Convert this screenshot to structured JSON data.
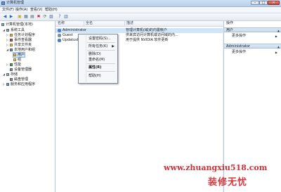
{
  "window": {
    "title": "计算机管理",
    "minimize_glyph": "–",
    "maximize_glyph": "□",
    "close_glyph": "✕"
  },
  "menubar": {
    "items": [
      "文件(F)",
      "操作(A)",
      "查看(V)",
      "帮助(H)"
    ]
  },
  "toolbar": {
    "buttons": [
      {
        "icon": "back-arrow-icon",
        "glyph": "◀",
        "color": "#2a6ab8"
      },
      {
        "icon": "forward-arrow-icon",
        "glyph": "▶",
        "color": "#2a6ab8"
      },
      {
        "icon": "up-folder-icon",
        "glyph": "▣",
        "color": "#caa23a"
      },
      {
        "icon": "show-hide-tree-icon",
        "glyph": "▦",
        "color": "#4a6f9e"
      },
      {
        "icon": "properties-icon",
        "glyph": "▤",
        "color": "#5a5a5a"
      },
      {
        "icon": "delete-icon",
        "glyph": "✖",
        "color": "#cc2222"
      },
      {
        "icon": "refresh-icon",
        "glyph": "⟳",
        "color": "#2a8a3a"
      },
      {
        "icon": "export-list-icon",
        "glyph": "▧",
        "color": "#4a6f9e"
      },
      {
        "icon": "help-icon",
        "glyph": "?",
        "color": "#2a5ab8"
      },
      {
        "icon": "action-pane-icon",
        "glyph": "▥",
        "color": "#4a6f9e"
      }
    ]
  },
  "tree": {
    "root": "计算机管理(本地)",
    "system_tools": "系统工具",
    "task_scheduler": "任务计划程序",
    "event_viewer": "事件查看器",
    "shared_folders": "共享文件夹",
    "local_users_groups": "本地用户和组",
    "users": "用户",
    "groups": "组",
    "performance": "性能",
    "device_manager": "设备管理器",
    "storage": "存储",
    "disk_management": "磁盘管理",
    "services_apps": "服务和应用程序"
  },
  "list": {
    "columns": [
      "名称",
      "全名",
      "描述"
    ],
    "rows": [
      {
        "name": "Administrator",
        "fullname": "",
        "description": "管理计算机(域)的内置帐户"
      },
      {
        "name": "Guest",
        "fullname": "",
        "description": "供来宾访问计算机或访问域的内..."
      },
      {
        "name": "UpdatusUser",
        "fullname": "",
        "description": "用于提供 NVIDIA 软件更新"
      }
    ]
  },
  "context_menu": {
    "items": [
      "设置密码(S)...",
      "所有任务(K)",
      "删除(D)",
      "重命名(M)",
      "属性(R)",
      "帮助(H)"
    ],
    "submenu_arrow": "▶"
  },
  "actions_pane": {
    "header": "操作",
    "section1": "用户",
    "section1_more": "更多操作",
    "section2": "Administrator",
    "section2_more": "更多操作",
    "collapse_glyph": "▲",
    "more_arrow": "▶"
  },
  "watermark": {
    "line1": "www.zhuangxiu518.com",
    "line2": "装修无忧"
  }
}
